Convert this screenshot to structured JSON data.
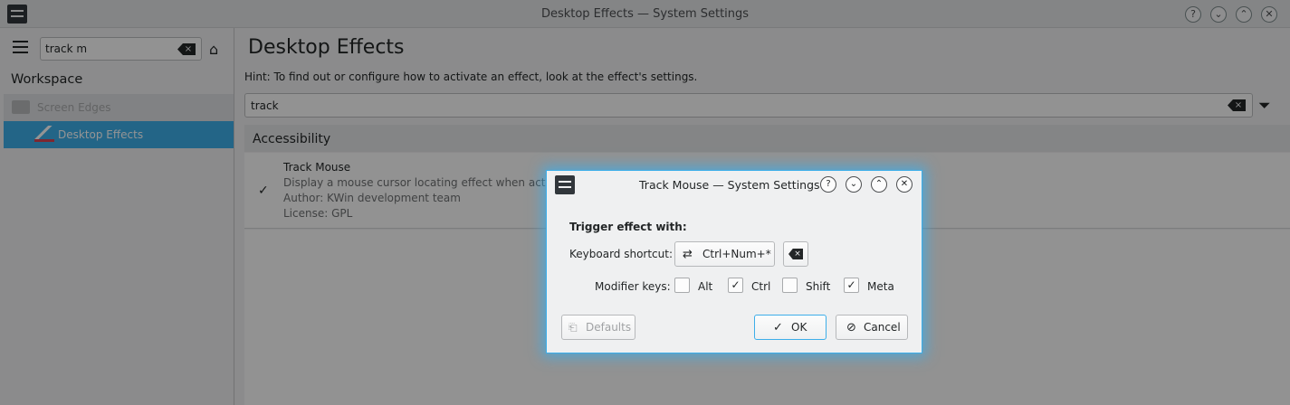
{
  "window": {
    "title": "Desktop Effects — System Settings",
    "controls": [
      "?",
      "⌄",
      "⌃",
      "✕"
    ]
  },
  "sidebar": {
    "search_value": "track m",
    "section_title": "Workspace",
    "items": [
      {
        "label": "Screen Edges",
        "state": "faded"
      },
      {
        "label": "Desktop Effects",
        "state": "selected"
      }
    ]
  },
  "main": {
    "title": "Desktop Effects",
    "hint": "Hint: To find out or configure how to activate an effect, look at the effect's settings.",
    "filter_value": "track",
    "category": "Accessibility",
    "effect": {
      "name": "Track Mouse",
      "description": "Display a mouse cursor locating effect when activated",
      "author": "Author: KWin development team",
      "license": "License: GPL",
      "enabled": true
    }
  },
  "dialog": {
    "title": "Track Mouse — System Settings",
    "controls": [
      "?",
      "⌄",
      "⌃",
      "✕"
    ],
    "trigger_label": "Trigger effect with:",
    "shortcut_label": "Keyboard shortcut:",
    "shortcut_value": "Ctrl+Num+*",
    "modifier_label": "Modifier keys:",
    "modifiers": [
      {
        "label": "Alt",
        "checked": false
      },
      {
        "label": "Ctrl",
        "checked": true
      },
      {
        "label": "Shift",
        "checked": false
      },
      {
        "label": "Meta",
        "checked": true
      }
    ],
    "defaults_label": "Defaults",
    "ok_label": "OK",
    "cancel_label": "Cancel"
  },
  "colors": {
    "accent": "#3daee9",
    "background": "#eff0f1",
    "text": "#232627"
  }
}
